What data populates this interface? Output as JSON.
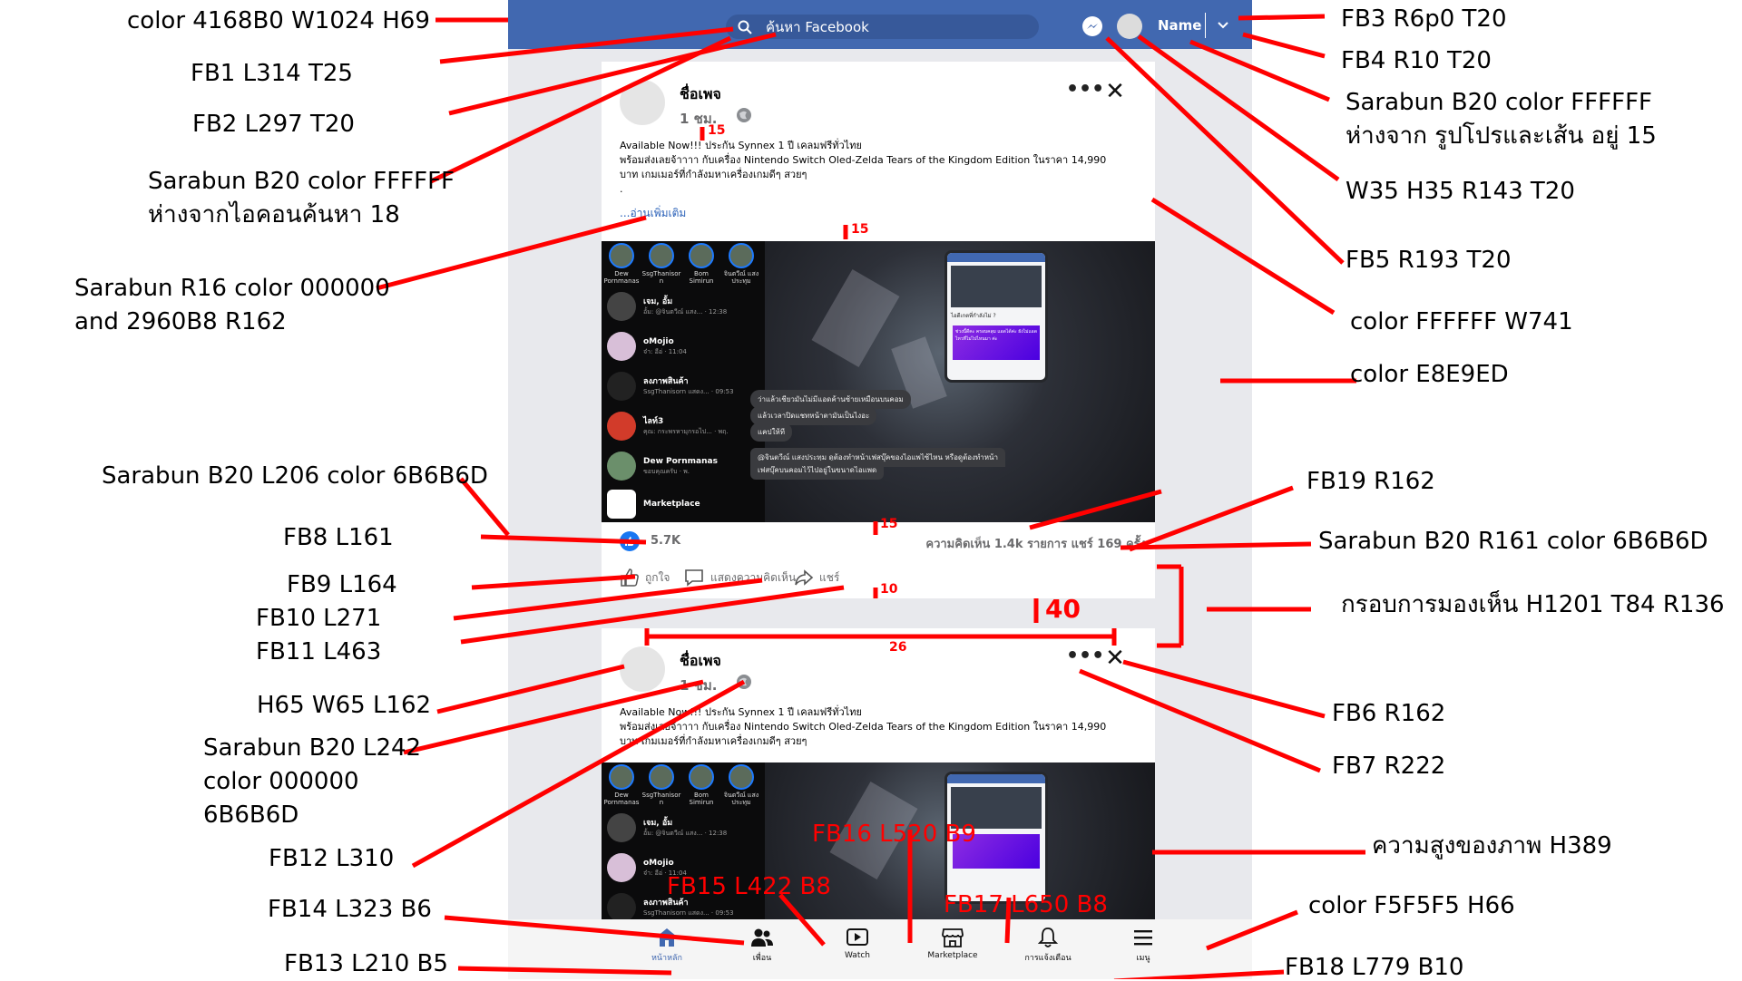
{
  "header": {
    "search_placeholder": "ค้นหา Facebook",
    "profile_name": "Name",
    "colors": {
      "header_bg": "#4168B0",
      "page_bg": "#E8E9ED",
      "card_bg": "#FFFFFF",
      "nav_bg": "#F5F5F5",
      "link": "#2960B8",
      "meta": "#6B6B6D"
    },
    "icons": [
      "search-icon",
      "messenger-icon",
      "chevron-down-icon"
    ]
  },
  "posts": [
    {
      "page_name": "ชื่อเพจ",
      "time": "1 ชม.",
      "text_lines": [
        "Available Now!!! ประกัน Synnex 1 ปี เคลมฟรีทั่วไทย",
        "พร้อมส่งเลยจ้าาาา กับเครื่อง Nintendo Switch Oled-Zelda Tears of the Kingdom Edition ในราคา 14,990",
        "บาท เกมเมอร์ที่กำลังมหาเครื่องเกมดีๆ สวยๆ",
        "."
      ],
      "read_more": "...อ่านเพิ่มเติม",
      "likes": "5.7K",
      "comment_share": "ความคิดเห็น 1.4k รายการ   แชร์ 169 ครั้ง",
      "actions": {
        "like": "ถูกใจ",
        "comment": "แสดงความคิดเห็น",
        "share": "แชร์"
      }
    },
    {
      "page_name": "ชื่อเพจ",
      "time": "1 ชม.",
      "text_lines": [
        "Available Now!!! ประกัน Synnex 1 ปี เคลมฟรีทั่วไทย",
        "พร้อมส่งเลยจ้าาาา กับเครื่อง Nintendo Switch Oled-Zelda Tears of the Kingdom Edition ในราคา 14,990",
        "บาท เกมเมอร์ที่กำลังมหาเครื่องเกมดีๆ สวยๆ"
      ]
    }
  ],
  "screenshot_chat": {
    "stories": [
      "Dew Pornmanas",
      "SsgThanisor n",
      "Bom Simirun",
      "จินตวีณ์ แสงประทุม"
    ],
    "chats": [
      {
        "title": "เจม, อั้ม",
        "sub": "อั้ม: @จินตวีณ์ แสง... · 12:38"
      },
      {
        "title": "oMojio",
        "sub": "จ๋า: อือ่ · 11:04"
      },
      {
        "title": "ลงภาพสินค้า",
        "sub": "SsgThanisorn แสดง... · 09:53"
      },
      {
        "title": "ไลท์3",
        "sub": "คุณ: กระพรหามุกรอไป... · พฤ."
      },
      {
        "title": "Dew Pornmanas",
        "sub": "ขอบคุณครับ · พ."
      },
      {
        "title": "Marketplace",
        "sub": ""
      }
    ],
    "bubbles": [
      "ว่าแล้วเชียวมันไม่มีแอดค้านซ้ายเหมือนบนคอม",
      "แล้วเวลาปิดแชทหน้าตามันเป็นไงอะ",
      "แคปให้ที",
      "@จินตวีณ์ แสงประทุม ดูต้องทำหน้าเฟสบุ๊คของไอแพไซ้ไหน หรือดูต้องทำหน้า",
      "เฟสบุ๊คบนคอมไว้ไปอยู่ในขนาดไอแพด"
    ],
    "inset_caption": "ไอดีเกตที่กำลังไม่ ?",
    "inset_purple_text": "ช่วงนี้ดีคะ ครอบคลุม แอดได้ค่ะ ยังไม่แอดไหวที่ไม่ไปไหนมา ค่ะ"
  },
  "bottom_nav": [
    {
      "label": "หน้าหลัก",
      "icon": "home-icon",
      "active": true
    },
    {
      "label": "เพื่อน",
      "icon": "friends-icon",
      "active": false
    },
    {
      "label": "Watch",
      "icon": "watch-icon",
      "active": false
    },
    {
      "label": "Marketplace",
      "icon": "marketplace-icon",
      "active": false
    },
    {
      "label": "การแจ้งเตือน",
      "icon": "bell-icon",
      "active": false
    },
    {
      "label": "เมนู",
      "icon": "menu-icon",
      "active": false
    }
  ],
  "annotations": {
    "left": [
      "color 4168B0 W1024 H69",
      "FB1 L314 T25",
      "FB2 L297 T20",
      "Sarabun B20 color FFFFFF",
      "ห่างจากไอคอนค้นหา 18",
      "Sarabun R16 color 000000",
      "and 2960B8 R162",
      "Sarabun B20 L206 color 6B6B6D",
      "FB8 L161",
      "FB9 L164",
      "FB10 L271",
      "FB11 L463",
      "H65 W65 L162",
      "Sarabun B20 L242",
      "color 000000",
      "6B6B6D",
      "FB12 L310",
      "FB14 L323 B6",
      "FB13 L210 B5"
    ],
    "right": [
      "FB3 R6p0 T20",
      "FB4 R10 T20",
      "Sarabun B20 color FFFFFF",
      "ห่างจาก รูปโปรและเส้น  อยู่ 15",
      "W35 H35 R143 T20",
      "FB5 R193 T20",
      "color FFFFFF  W741",
      "color E8E9ED",
      "FB19 R162",
      "Sarabun B20 R161 color 6B6B6D",
      "กรอบการมองเห็น H1201 T84 R136",
      "FB6 R162",
      "FB7 R222",
      "ความสูงของภาพ H389",
      "color F5F5F5 H66",
      "FB18 L779 B10"
    ],
    "overlay": [
      "FB16 L520 B9",
      "FB15 L422 B8",
      "FB17 L650 B8"
    ],
    "measures": [
      "15",
      "15",
      "15",
      "10",
      "40",
      "26"
    ]
  }
}
